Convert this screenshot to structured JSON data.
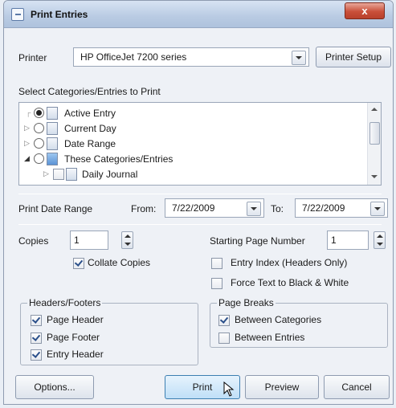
{
  "window": {
    "title": "Print Entries",
    "close_glyph": "x"
  },
  "printer": {
    "label": "Printer",
    "selected": "HP OfficeJet 7200 series",
    "setup_label": "Printer Setup"
  },
  "categories": {
    "label": "Select Categories/Entries to Print",
    "items": [
      {
        "label": "Active Entry"
      },
      {
        "label": "Current Day"
      },
      {
        "label": "Date Range"
      },
      {
        "label": "These Categories/Entries"
      },
      {
        "label": "Daily Journal"
      }
    ]
  },
  "date_range": {
    "label": "Print Date Range",
    "from_label": "From:",
    "from_value": "7/22/2009",
    "to_label": "To:",
    "to_value": "7/22/2009"
  },
  "copies": {
    "label": "Copies",
    "value": "1",
    "collate_label": "Collate Copies",
    "collate_checked": true
  },
  "starting_page": {
    "label": "Starting Page Number",
    "value": "1"
  },
  "entry_index": {
    "label": "Entry Index (Headers Only)",
    "checked": false
  },
  "force_bw": {
    "label": "Force Text to Black & White",
    "checked": false
  },
  "headers_footers": {
    "title": "Headers/Footers",
    "page_header": "Page Header",
    "page_footer": "Page Footer",
    "entry_header": "Entry Header"
  },
  "page_breaks": {
    "title": "Page Breaks",
    "between_categories": "Between Categories",
    "between_entries": "Between Entries"
  },
  "buttons": {
    "options": "Options...",
    "print": "Print",
    "preview": "Preview",
    "cancel": "Cancel"
  }
}
